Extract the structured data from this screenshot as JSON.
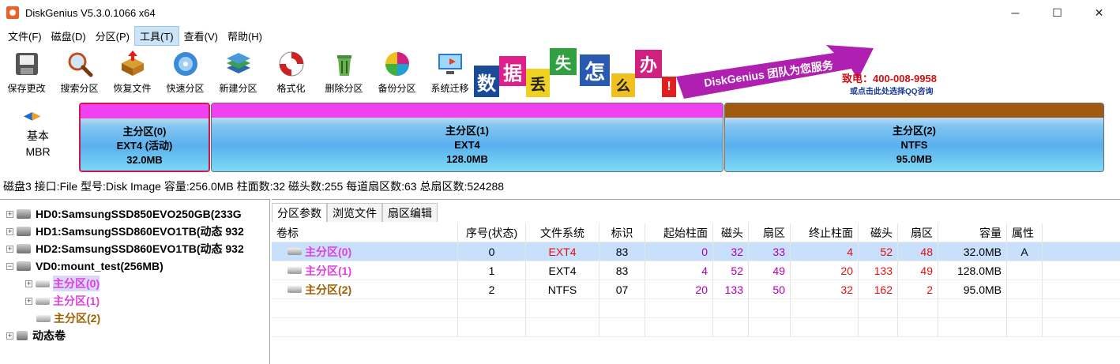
{
  "window": {
    "title": "DiskGenius V5.3.0.1066 x64",
    "minimize": "─",
    "maximize": "☐",
    "close": "✕"
  },
  "menu": [
    "文件(F)",
    "磁盘(D)",
    "分区(P)",
    "工具(T)",
    "查看(V)",
    "帮助(H)"
  ],
  "toolbar": [
    "保存更改",
    "搜索分区",
    "恢复文件",
    "快速分区",
    "新建分区",
    "格式化",
    "删除分区",
    "备份分区",
    "系统迁移"
  ],
  "banner": {
    "chars": [
      "数",
      "据",
      "丢",
      "失",
      "怎",
      "么",
      "办",
      "!"
    ],
    "slogan": "DiskGenius 团队为您服务",
    "phone": "致电：400-008-9958",
    "qq": "或点击此处选择QQ咨询"
  },
  "diskmap": {
    "type_line1": "基本",
    "type_line2": "MBR",
    "partitions": [
      {
        "name": "主分区(0)",
        "fs": "EXT4 (活动)",
        "size": "32.0MB"
      },
      {
        "name": "主分区(1)",
        "fs": "EXT4",
        "size": "128.0MB"
      },
      {
        "name": "主分区(2)",
        "fs": "NTFS",
        "size": "95.0MB"
      }
    ]
  },
  "disk_info": "磁盘3 接口:File  型号:Disk Image  容量:256.0MB  柱面数:32  磁头数:255  每道扇区数:63  总扇区数:524288",
  "tree": {
    "disks": [
      "HD0:SamsungSSD850EVO250GB(233G",
      "HD1:SamsungSSD860EVO1TB(动态 932",
      "HD2:SamsungSSD860EVO1TB(动态 932",
      "VD0:mount_test(256MB)"
    ],
    "partitions": [
      "主分区(0)",
      "主分区(1)",
      "主分区(2)"
    ],
    "dynamic": "动态卷"
  },
  "tabs": [
    "分区参数",
    "浏览文件",
    "扇区编辑"
  ],
  "table": {
    "headers": [
      "卷标",
      "序号(状态)",
      "文件系统",
      "标识",
      "起始柱面",
      "磁头",
      "扇区",
      "终止柱面",
      "磁头",
      "扇区",
      "容量",
      "属性"
    ],
    "rows": [
      [
        "主分区(0)",
        "0",
        "EXT4",
        "83",
        "0",
        "32",
        "33",
        "4",
        "52",
        "48",
        "32.0MB",
        "A"
      ],
      [
        "主分区(1)",
        "1",
        "EXT4",
        "83",
        "4",
        "52",
        "49",
        "20",
        "133",
        "49",
        "128.0MB",
        ""
      ],
      [
        "主分区(2)",
        "2",
        "NTFS",
        "07",
        "20",
        "133",
        "50",
        "32",
        "162",
        "2",
        "95.0MB",
        ""
      ]
    ]
  }
}
